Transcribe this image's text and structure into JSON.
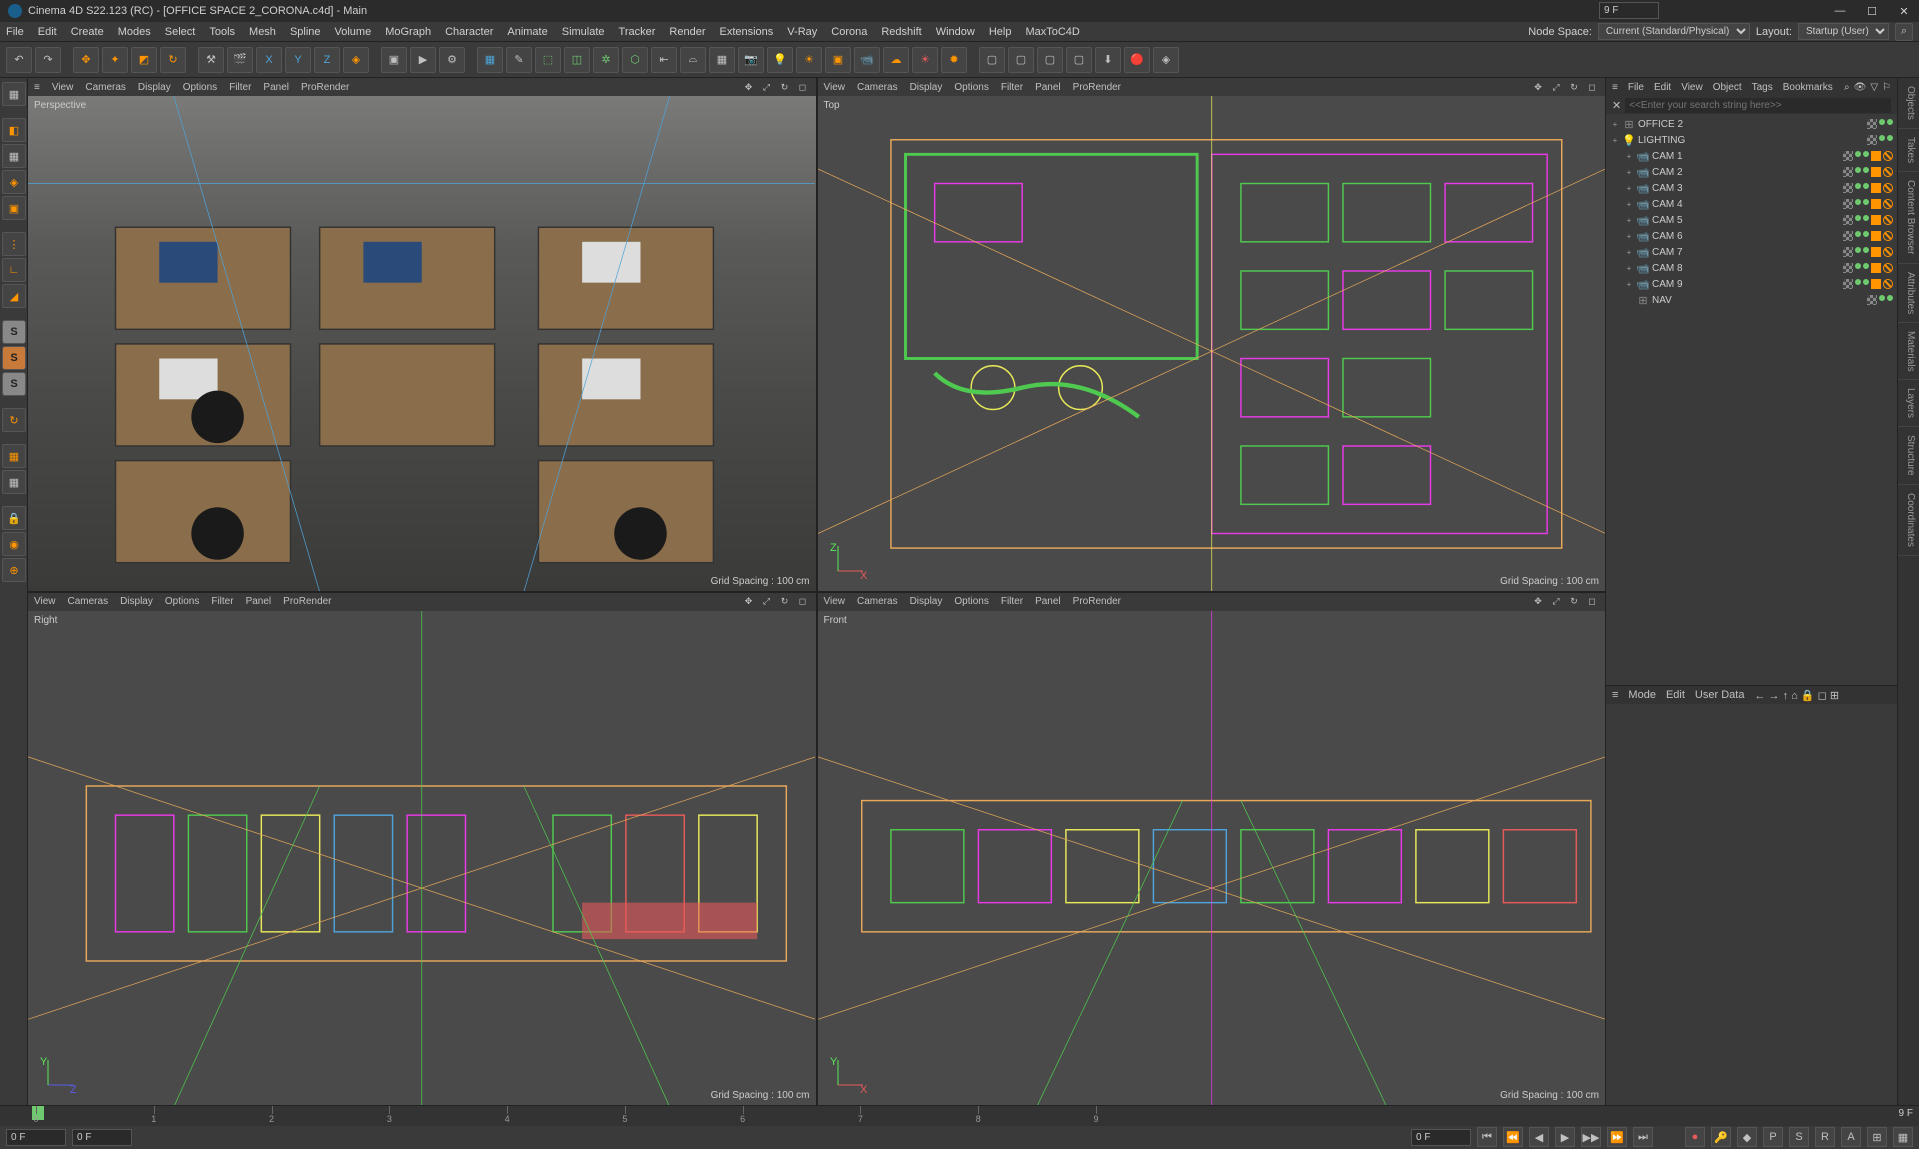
{
  "titlebar": {
    "text": "Cinema 4D S22.123 (RC) - [OFFICE SPACE 2_CORONA.c4d] - Main"
  },
  "menubar": {
    "items": [
      "File",
      "Edit",
      "Create",
      "Modes",
      "Select",
      "Tools",
      "Mesh",
      "Spline",
      "Volume",
      "MoGraph",
      "Character",
      "Animate",
      "Simulate",
      "Tracker",
      "Render",
      "Extensions",
      "V-Ray",
      "Corona",
      "Redshift",
      "Window",
      "Help",
      "MaxToC4D"
    ],
    "node_space_label": "Node Space:",
    "node_space_value": "Current (Standard/Physical)",
    "layout_label": "Layout:",
    "layout_value": "Startup (User)"
  },
  "viewports": {
    "menu_items": [
      "View",
      "Cameras",
      "Display",
      "Options",
      "Filter",
      "Panel",
      "ProRender"
    ],
    "perspective": {
      "label": "Perspective",
      "grid": "Grid Spacing : 100 cm"
    },
    "top": {
      "label": "Top",
      "grid": "Grid Spacing : 100 cm"
    },
    "right": {
      "label": "Right",
      "grid": "Grid Spacing : 100 cm"
    },
    "front": {
      "label": "Front",
      "grid": "Grid Spacing : 100 cm"
    }
  },
  "objects_panel": {
    "menu": [
      "File",
      "Edit",
      "View",
      "Object",
      "Tags",
      "Bookmarks"
    ],
    "search_placeholder": "<<Enter your search string here>>",
    "items": [
      {
        "label": "OFFICE 2",
        "type": "null",
        "indent": 0,
        "expander": "+"
      },
      {
        "label": "LIGHTING",
        "type": "light",
        "indent": 0,
        "expander": "+"
      },
      {
        "label": "CAM 1",
        "type": "camera",
        "indent": 1,
        "expander": "+"
      },
      {
        "label": "CAM 2",
        "type": "camera",
        "indent": 1,
        "expander": "+"
      },
      {
        "label": "CAM 3",
        "type": "camera",
        "indent": 1,
        "expander": "+"
      },
      {
        "label": "CAM 4",
        "type": "camera",
        "indent": 1,
        "expander": "+"
      },
      {
        "label": "CAM 5",
        "type": "camera",
        "indent": 1,
        "expander": "+"
      },
      {
        "label": "CAM 6",
        "type": "camera",
        "indent": 1,
        "expander": "+"
      },
      {
        "label": "CAM 7",
        "type": "camera",
        "indent": 1,
        "expander": "+"
      },
      {
        "label": "CAM 8",
        "type": "camera",
        "indent": 1,
        "expander": "+"
      },
      {
        "label": "CAM 9",
        "type": "camera",
        "indent": 1,
        "expander": "+"
      },
      {
        "label": "NAV",
        "type": "null",
        "indent": 1,
        "expander": ""
      }
    ]
  },
  "attributes_panel": {
    "menu": [
      "Mode",
      "Edit",
      "User Data"
    ]
  },
  "right_tabs": [
    "Objects",
    "Takes",
    "Content Browser",
    "Attributes",
    "Materials",
    "Layers",
    "Structure",
    "Coordinates"
  ],
  "timeline": {
    "ticks": [
      "0",
      "1",
      "2",
      "3",
      "4",
      "5",
      "6",
      "7",
      "8",
      "9"
    ],
    "current_frame": "0 F",
    "end_frame": "9 F",
    "start_field": "0 F",
    "range_field": "0 F"
  }
}
